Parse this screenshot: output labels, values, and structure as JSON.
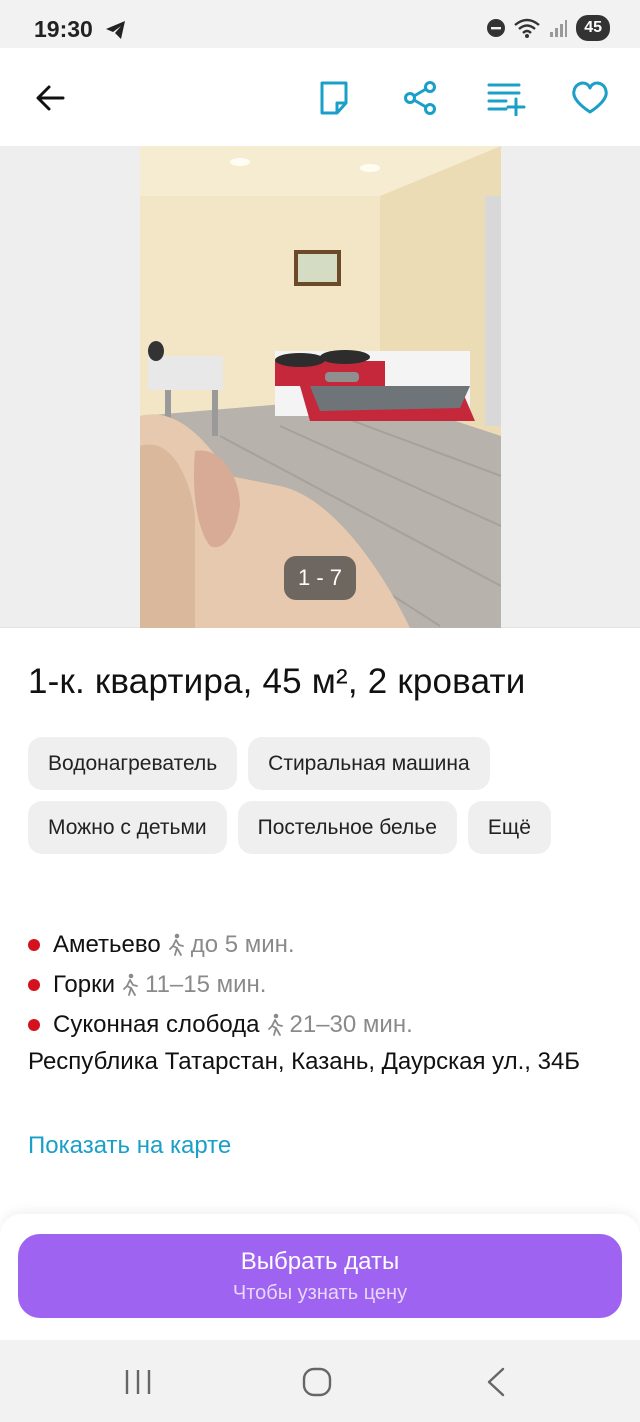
{
  "status_bar": {
    "time": "19:30",
    "battery": "45"
  },
  "app_bar": {
    "icons": [
      "back-arrow-icon",
      "note-icon",
      "share-icon",
      "compare-list-icon",
      "heart-icon"
    ]
  },
  "gallery": {
    "counter": "1 - 7"
  },
  "listing": {
    "title": "1-к. квартира, 45 м², 2 кровати",
    "amenities_row1": [
      "Водонагреватель",
      "Стиральная машина"
    ],
    "amenities_row2": [
      "Можно с детьми",
      "Постельное белье",
      "Ещё"
    ],
    "metro": [
      {
        "name": "Аметьево",
        "time": "до 5 мин.",
        "line_color": "#d3121e"
      },
      {
        "name": "Горки",
        "time": "11–15 мин.",
        "line_color": "#d3121e"
      },
      {
        "name": "Суконная слобода",
        "time": "21–30 мин.",
        "line_color": "#d3121e"
      }
    ],
    "address": "Республика Татарстан, Казань, Даурская ул., 34Б",
    "map_link": "Показать на карте"
  },
  "cta": {
    "label": "Выбрать даты",
    "sublabel": "Чтобы узнать цену",
    "color": "#9f63f1"
  },
  "colors": {
    "accent": "#1aa0c8",
    "metro_red": "#d3121e"
  }
}
